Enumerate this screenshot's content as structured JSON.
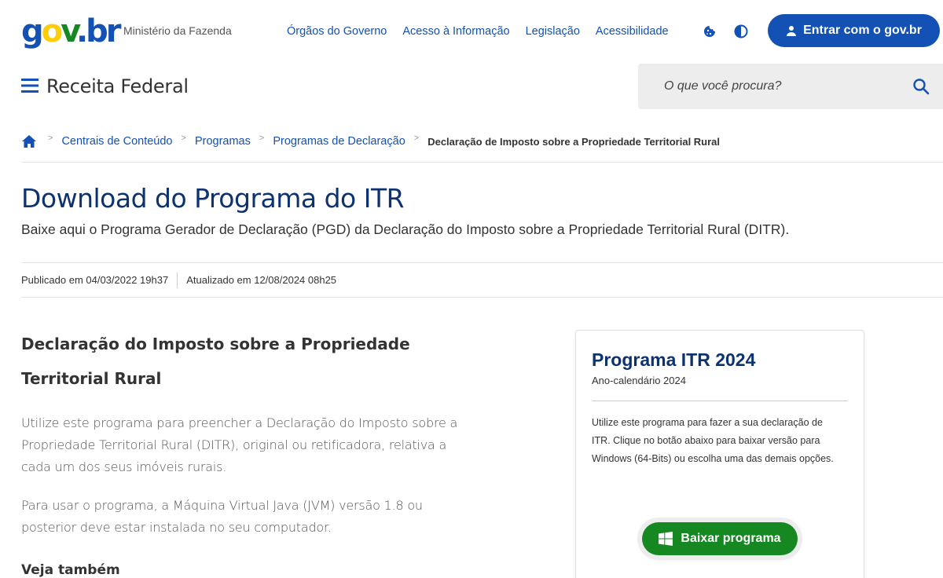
{
  "header": {
    "logo": "gov.br",
    "ministry": "Ministério da Fazenda",
    "nav": [
      "Órgãos do Governo",
      "Acesso à Informação",
      "Legislação",
      "Acessibilidade"
    ],
    "login_label": "Entrar com o gov.br",
    "site_title": "Receita Federal",
    "search_placeholder": "O que você procura?",
    "colors": {
      "primary": "#1351b4",
      "title": "#0c326f",
      "success": "#168821"
    }
  },
  "breadcrumb": {
    "items": [
      "Centrais de Conteúdo",
      "Programas",
      "Programas de Declaração"
    ],
    "current": "Declaração de Imposto sobre a Propriedade Territorial Rural"
  },
  "page": {
    "title": "Download do Programa do ITR",
    "description": "Baixe aqui o Programa Gerador de Declaração (PGD) da Declaração do Imposto sobre a Propriedade Territorial Rural (DITR).",
    "published": "Publicado em 04/03/2022 19h37",
    "updated": "Atualizado em 12/08/2024 08h25"
  },
  "content": {
    "heading": "Declaração do Imposto sobre a Propriedade Territorial Rural",
    "para1": "Utilize este programa para preencher a Declaração do Imposto sobre a Propriedade Territorial Rural (DITR), original ou retificadora, relativa a cada um dos seus imóveis rurais.",
    "para2": "Para usar o programa, a Máquina Virtual Java (JVM) versão 1.8 ou posterior deve estar instalada no seu computador.",
    "see_also": "Veja também"
  },
  "card": {
    "title": "Programa ITR 2024",
    "subtitle": "Ano-calendário 2024",
    "text": "Utilize este programa para fazer a sua declaração de ITR. Clique no botão abaixo para baixar versão para Windows (64-Bits) ou escolha uma das demais opções.",
    "button_label": "Baixar programa"
  }
}
